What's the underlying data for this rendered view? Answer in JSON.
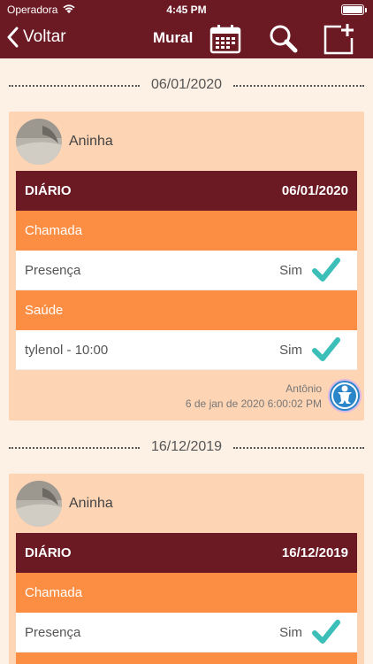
{
  "statusbar": {
    "carrier": "Operadora",
    "time": "4:45 PM"
  },
  "navbar": {
    "back_label": "Voltar",
    "title": "Mural"
  },
  "posts": [
    {
      "date_separator": "06/01/2020",
      "user_name": "Aninha",
      "diary_label": "DIÁRIO",
      "diary_date": "06/01/2020",
      "sections": [
        {
          "category": "Chamada",
          "item": "Presença",
          "value": "Sim"
        },
        {
          "category": "Saúde",
          "item": "tylenol - 10:00",
          "value": "Sim"
        }
      ],
      "author": "Antônio",
      "timestamp": "6 de jan de 2020 6:00:02 PM"
    },
    {
      "date_separator": "16/12/2019",
      "user_name": "Aninha",
      "diary_label": "DIÁRIO",
      "diary_date": "16/12/2019",
      "sections": [
        {
          "category": "Chamada",
          "item": "Presença",
          "value": "Sim"
        }
      ]
    }
  ],
  "colors": {
    "primary": "#6b1a24",
    "category": "#fc8e43",
    "card_bg": "#fdd4b4",
    "page_bg": "#fdf0e4",
    "check": "#3bbfb8"
  }
}
